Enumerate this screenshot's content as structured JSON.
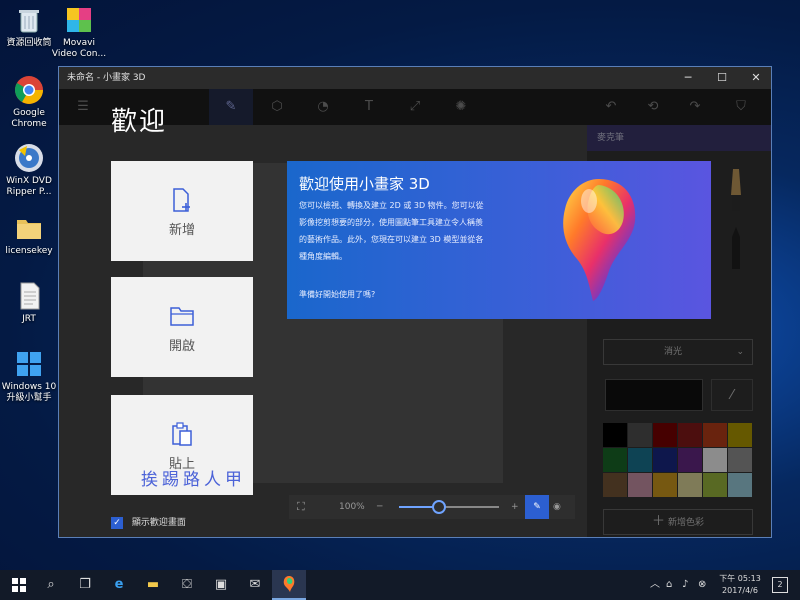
{
  "desktop": {
    "icons": [
      {
        "label": "資源回收筒",
        "icon": "recycle-bin-icon"
      },
      {
        "label": "Movavi\nVideo Con...",
        "icon": "movavi-icon"
      },
      {
        "label": "Google\nChrome",
        "icon": "chrome-icon"
      },
      {
        "label": "WinX DVD\nRipper P...",
        "icon": "dvd-icon"
      },
      {
        "label": "licensekey",
        "icon": "folder-icon"
      },
      {
        "label": "JRT",
        "icon": "document-icon"
      },
      {
        "label": "Windows 10\n升級小幫手",
        "icon": "windows-icon"
      }
    ]
  },
  "window": {
    "title": "未命名 - 小畫家 3D",
    "minimize": "─",
    "maximize": "☐",
    "close": "✕"
  },
  "toolbar": {
    "menu": "☰",
    "tools": [
      {
        "name": "art-tools",
        "glyph": "✎",
        "active": true
      },
      {
        "name": "3d-objects",
        "glyph": "⬡"
      },
      {
        "name": "stickers",
        "glyph": "◔"
      },
      {
        "name": "text",
        "glyph": "T"
      },
      {
        "name": "effects",
        "glyph": "⤢"
      },
      {
        "name": "brightness",
        "glyph": "✺"
      }
    ],
    "right": [
      "↶",
      "⟲",
      "↷",
      "⛉"
    ]
  },
  "right_panel": {
    "header": "麥克筆",
    "dropdown": "消光",
    "add_color": "新增色彩",
    "colors": [
      "#000000",
      "#555555",
      "#800000",
      "#8b1a1a",
      "#c0401a",
      "#b8a000",
      "#1a6e2a",
      "#1a7a9a",
      "#1a2a8a",
      "#6a2a8a",
      "#ffffff",
      "#999999",
      "#7a5a3a",
      "#d29ab0",
      "#d8a020",
      "#e8e0a0",
      "#a0c040",
      "#a0d8e8"
    ]
  },
  "welcome": {
    "title": "歡迎",
    "cards": [
      {
        "label": "新增",
        "icon": "new-file-icon"
      },
      {
        "label": "開啟",
        "icon": "open-folder-icon"
      },
      {
        "label": "貼上",
        "icon": "paste-icon"
      }
    ],
    "banner_title": "歡迎使用小畫家 3D",
    "banner_body": "您可以檢視、轉換及建立 2D 或 3D 物件。您可以從影像挖剪想要的部分，使用圖點筆工具建立令人稱羨的藝術作品。此外，您現在可以建立 3D 模型並從各種角度編輯。",
    "banner_question": "準備好開始使用了嗎?",
    "show_welcome": "顯示歡迎畫面",
    "watermark": "挨踢路人甲"
  },
  "zoom": {
    "value": "100%",
    "minus": "─",
    "plus": "+",
    "level": 0.4
  },
  "taskbar": {
    "time": "下午 05:13",
    "date": "2017/4/6",
    "notifications": "2"
  }
}
